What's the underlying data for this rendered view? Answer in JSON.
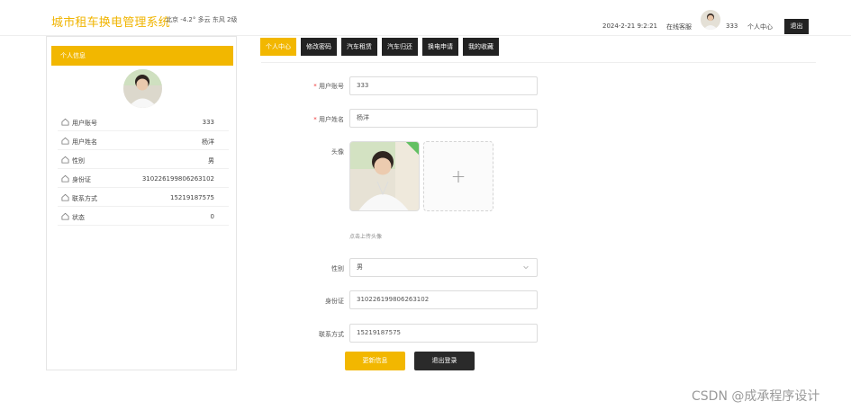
{
  "header": {
    "title": "城市租车换电管理系统",
    "weather": "北京  -4.2°  多云  东风  2级",
    "datetime": "2024-2-21 9:2:21",
    "service": "在线客服",
    "username": "333",
    "center": "个人中心",
    "logout": "退出"
  },
  "left_panel": {
    "title": "个人信息",
    "rows": [
      {
        "label": "用户账号",
        "value": "333"
      },
      {
        "label": "用户姓名",
        "value": "杨洋"
      },
      {
        "label": "性别",
        "value": "男"
      },
      {
        "label": "身份证",
        "value": "310226199806263102"
      },
      {
        "label": "联系方式",
        "value": "15219187575"
      },
      {
        "label": "状态",
        "value": "0"
      }
    ]
  },
  "tabs": [
    {
      "label": "个人中心",
      "active": true
    },
    {
      "label": "修改密码",
      "active": false
    },
    {
      "label": "汽车租赁",
      "active": false
    },
    {
      "label": "汽车归还",
      "active": false
    },
    {
      "label": "换电申请",
      "active": false
    },
    {
      "label": "我的收藏",
      "active": false
    }
  ],
  "form": {
    "account_label": "用户账号",
    "account_value": "333",
    "name_label": "用户姓名",
    "name_value": "杨洋",
    "avatar_label": "头像",
    "avatar_hint": "点击上传头像",
    "gender_label": "性别",
    "gender_value": "男",
    "id_label": "身份证",
    "id_value": "310226199806263102",
    "phone_label": "联系方式",
    "phone_value": "15219187575",
    "update_button": "更新信息",
    "logout_button": "退出登录",
    "required_mark": "*"
  },
  "colors": {
    "accent": "#f2b700",
    "dark": "#222222"
  },
  "watermark": "CSDN @成承程序设计"
}
